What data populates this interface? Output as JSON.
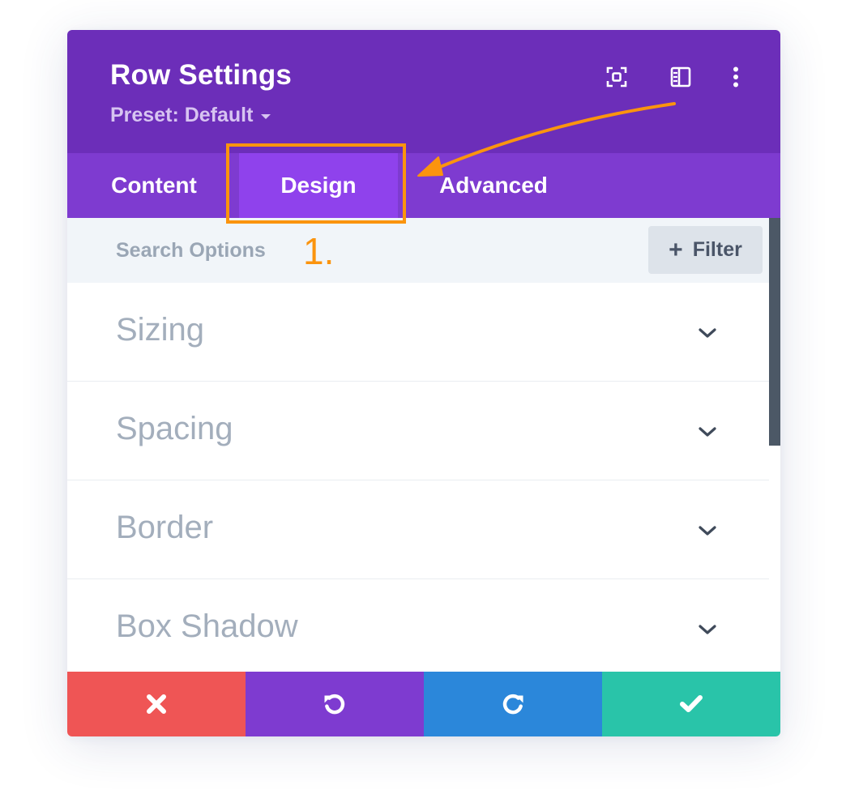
{
  "modal": {
    "title": "Row Settings",
    "preset_label": "Preset: Default",
    "header_icons": [
      "fullscreen-icon",
      "sidebar-layout-icon",
      "more-options-icon"
    ]
  },
  "tabs": [
    {
      "label": "Content",
      "active": false
    },
    {
      "label": "Design",
      "active": true
    },
    {
      "label": "Advanced",
      "active": false
    }
  ],
  "search": {
    "placeholder": "Search Options",
    "value": "",
    "filter_label": "Filter"
  },
  "sections": [
    {
      "label": "Sizing"
    },
    {
      "label": "Spacing"
    },
    {
      "label": "Border"
    },
    {
      "label": "Box Shadow"
    }
  ],
  "footer": {
    "buttons": [
      {
        "name": "cancel",
        "icon": "close-icon",
        "color": "#ef5555"
      },
      {
        "name": "undo",
        "icon": "undo-icon",
        "color": "#7e3bd0"
      },
      {
        "name": "redo",
        "icon": "redo-icon",
        "color": "#2b87da"
      },
      {
        "name": "save",
        "icon": "check-icon",
        "color": "#29c4a9"
      }
    ]
  },
  "annotation": {
    "step_label": "1.",
    "color": "#fb940e"
  },
  "colors": {
    "header_bg": "#6c2eb9",
    "tabs_bg": "#7e3bd0",
    "active_tab_bg": "#8f42ec"
  }
}
